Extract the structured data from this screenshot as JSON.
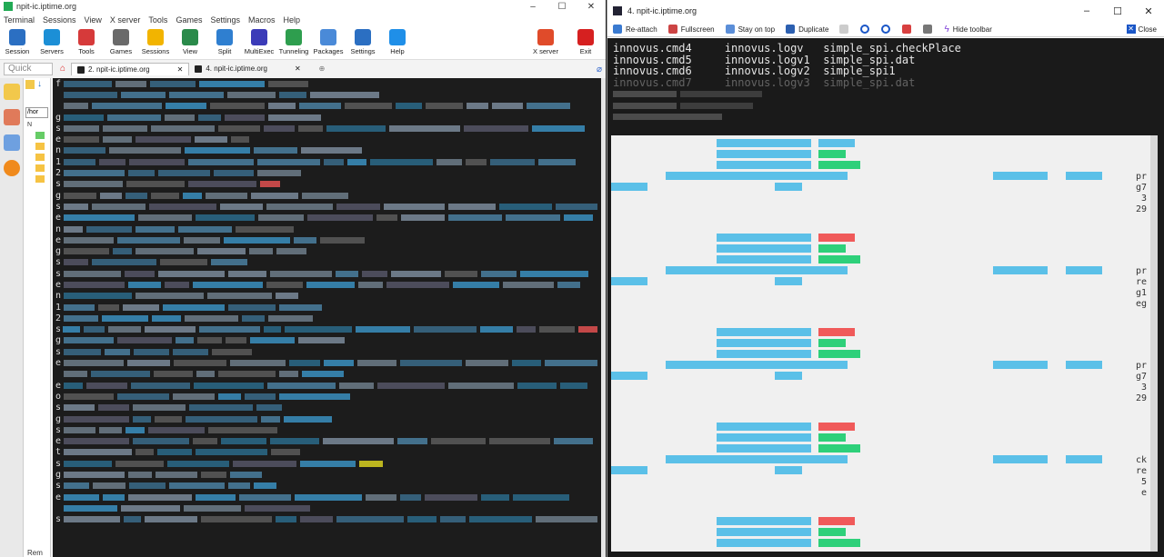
{
  "left_window": {
    "title": "npit-ic.iptime.org",
    "window_buttons": [
      "–",
      "☐",
      "✕"
    ],
    "menu": [
      "Terminal",
      "Sessions",
      "View",
      "X server",
      "Tools",
      "Games",
      "Settings",
      "Macros",
      "Help"
    ],
    "toolbar": [
      {
        "label": "Session",
        "icon": "monitor-icon",
        "color": "#2b6fc2"
      },
      {
        "label": "Servers",
        "icon": "servers-icon",
        "color": "#1c8fd6"
      },
      {
        "label": "Tools",
        "icon": "tools-icon",
        "color": "#d63a3a"
      },
      {
        "label": "Games",
        "icon": "gamepad-icon",
        "color": "#6a6a6a"
      },
      {
        "label": "Sessions",
        "icon": "star-icon",
        "color": "#f2b400"
      },
      {
        "label": "View",
        "icon": "view-icon",
        "color": "#2a8a4a"
      },
      {
        "label": "Split",
        "icon": "split-icon",
        "color": "#2f7fd0"
      },
      {
        "label": "MultiExec",
        "icon": "multiexec-icon",
        "color": "#3b3bb8"
      },
      {
        "label": "Tunneling",
        "icon": "tunnel-icon",
        "color": "#2e9e4e"
      },
      {
        "label": "Packages",
        "icon": "packages-icon",
        "color": "#4a8ad8"
      },
      {
        "label": "Settings",
        "icon": "gear-icon",
        "color": "#2b6fc2"
      },
      {
        "label": "Help",
        "icon": "help-icon",
        "color": "#1f8fe8"
      }
    ],
    "toolbar_right": [
      {
        "label": "X server",
        "icon": "x-server-icon",
        "color": "#e04b2a"
      },
      {
        "label": "Exit",
        "icon": "power-icon",
        "color": "#d62020"
      }
    ],
    "quick_connect_placeholder": "Quick connect...",
    "tabs": [
      {
        "label": "2. npit-ic.iptime.org",
        "active": true,
        "close": "✕"
      },
      {
        "label": "4. npit-ic.iptime.org",
        "active": false,
        "close": "✕"
      }
    ],
    "file_path": "/hor",
    "tree_root": "N",
    "first_chars": [
      "f",
      "",
      "",
      "g",
      "s",
      "e",
      "n",
      "1",
      "2",
      "s",
      "g",
      "s",
      "e",
      "n",
      "e",
      "g",
      "s",
      "s",
      "e",
      "n",
      "1",
      "2",
      "s",
      "g",
      "s",
      "e",
      "",
      "e",
      "o",
      "s",
      "g",
      "s",
      "e",
      "t",
      "s",
      "g",
      "s",
      "e",
      "",
      "s"
    ],
    "bottom_label": "Rem"
  },
  "right_window": {
    "title": "4. npit-ic.iptime.org",
    "window_buttons": [
      "–",
      "☐",
      "✕"
    ],
    "toolbar": [
      {
        "label": "Re-attach",
        "icon": "reattach-icon"
      },
      {
        "label": "Fullscreen",
        "icon": "fullscreen-icon"
      },
      {
        "label": "Stay on top",
        "icon": "stay-on-top-icon"
      },
      {
        "label": "Duplicate",
        "icon": "duplicate-icon"
      }
    ],
    "toolbar_icons": [
      "edit-icon",
      "zoom-in-icon",
      "zoom-out-icon",
      "save-icon",
      "print-icon"
    ],
    "hide_toolbar_label": "Hide toolbar",
    "close_label": "Close",
    "terminal_lines": [
      "innovus.cmd4     innovus.logv   simple_spi.checkPlace",
      "innovus.cmd5     innovus.logv1  simple_spi.dat",
      "innovus.cmd6     innovus.logv2  simple_spi1",
      "innovus.cmd7     innovus.logv3  simple_spi.dat"
    ],
    "right_edge_chars": [
      "pr",
      "g7",
      "3",
      "29",
      "pr",
      "re",
      "g1",
      "eg",
      "pr",
      "g7",
      "3",
      "29",
      "ck",
      "re",
      "5",
      "e"
    ]
  }
}
